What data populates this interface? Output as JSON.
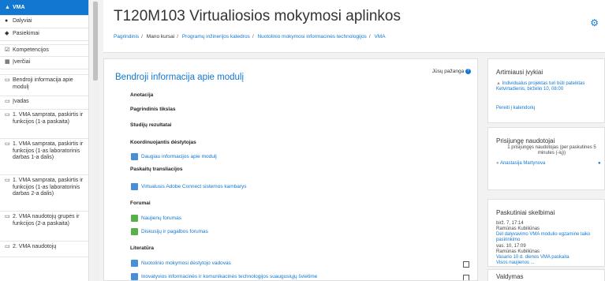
{
  "sidebar": {
    "items": [
      {
        "icon": "mortarboard-icon",
        "label": "VMA"
      },
      {
        "icon": "users-icon",
        "label": "Dalyviai"
      },
      {
        "icon": "shield-icon",
        "label": "Pasiekimai"
      },
      {
        "icon": "check-square-icon",
        "label": "Kompetencijos"
      },
      {
        "icon": "table-icon",
        "label": "Įverčiai"
      },
      {
        "icon": "folder-icon",
        "label": "Bendroji informacija apie modulį"
      },
      {
        "icon": "folder-icon",
        "label": "Įvadas"
      },
      {
        "icon": "folder-icon",
        "label": "1. VMA samprata, paskirtis ir funkcijos (1-a paskaita)"
      },
      {
        "icon": "folder-icon",
        "label": "1. VMA samprata, paskirtis ir funkcijos (1-as laboratorinis darbas 1-a dalis)"
      },
      {
        "icon": "folder-icon",
        "label": "1. VMA samprata, paskirtis ir funkcijos (1-as laboratorinis darbas 2-a dalis)"
      },
      {
        "icon": "folder-icon",
        "label": "2. VMA naudotojų grupės ir funkcijos (2-a paskaita)"
      },
      {
        "icon": "folder-icon",
        "label": "2. VMA naudotojų"
      }
    ]
  },
  "header": {
    "title": "T120M103 Virtualiosios mokymosi aplinkos",
    "breadcrumbs": [
      "Pagrindinis",
      "Mano kursai",
      "Programų inžinerijos katedros",
      "Nuotolinio mokymosi informacinės technologijos",
      "VMA"
    ]
  },
  "main": {
    "section_title": "Bendroji informacija apie modulį",
    "progress_label": "Jūsų pažanga",
    "progress_help": "?",
    "headings": {
      "anotacija": "Anotacija",
      "tikslas": "Pagrindinis tikslas",
      "rezultatai": "Studijų rezultatai",
      "destytojas": "Koordinuojantis dėstytojas",
      "transliacijos": "Paskaitų transliacijos",
      "forumai": "Forumai",
      "literatura": "Literatūra"
    },
    "activities": {
      "daugiau": "Daugiau informacijos apie modulį",
      "adobe": "Virtualusis Adobe Connect sistemos kambarys",
      "naujienu": "Naujienų forumas",
      "diskusiju": "Diskusijų ir pagalbos forumas",
      "vadovas": "Nuotolinio mokymosi dėstytojo vadovas",
      "inovatyvios": "Inovatyvios informacinės ir komunikacinės technologijos suaugusiųjų švietime"
    }
  },
  "events": {
    "title": "Artimiausi įvykiai",
    "event_text": "Individualus projektas turi būti pateiktas",
    "event_date": "Ketvirtadienis, birželio 10, 08:00",
    "calendar_link": "Pereiti į kalendorių"
  },
  "online": {
    "title": "Prisijungę naudotojai",
    "count_text": "1 prisijungęs naudotojas (per paskutines 5 minutes (-ių))",
    "user": "Anastasija Martynova"
  },
  "news": {
    "title": "Paskutiniai skelbimai",
    "items": [
      {
        "date": "birž. 7, 17:14",
        "author": "Ramūnas Kubiliūnas",
        "text": "Dėl dalyvavimo VMA modulio egzamine laiko pasirinkimo"
      },
      {
        "date": "vas. 10, 17:09",
        "author": "Ramūnas Kubiliūnas",
        "text": "Vasario 10 d. dienos VMA paskaita"
      }
    ],
    "all_link": "Visos naujienos ..."
  },
  "admin": {
    "title": "Valdymas"
  },
  "colors": {
    "accent": "#1177d1",
    "background": "#f2f2f2"
  }
}
